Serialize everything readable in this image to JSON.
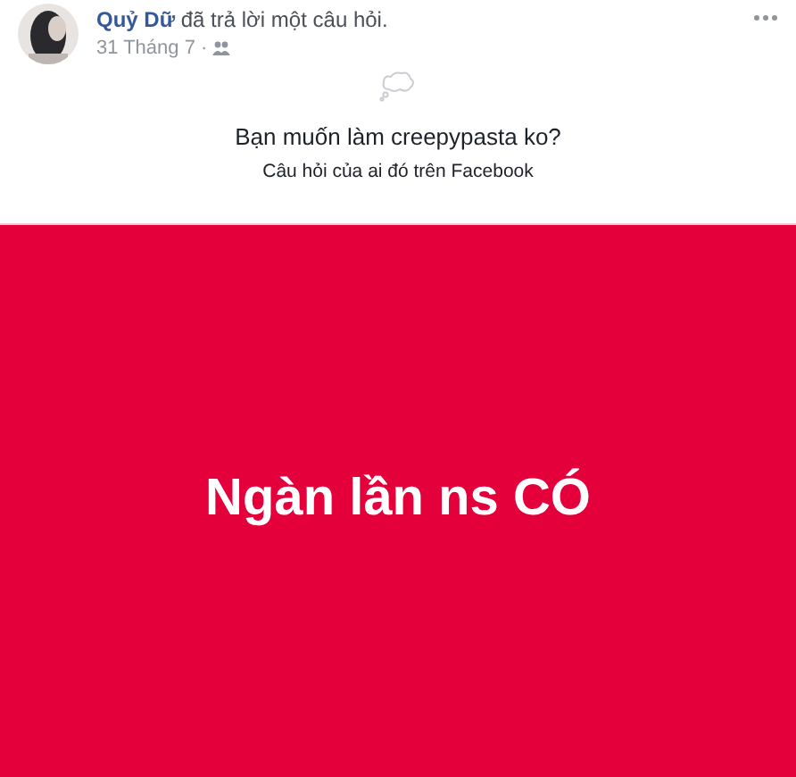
{
  "post": {
    "author": "Quỷ Dữ",
    "action": "đã trả lời một câu hỏi.",
    "date": "31 Tháng 7 ·"
  },
  "question": {
    "text": "Bạn muốn làm creepypasta ko?",
    "source": "Câu hỏi của ai đó trên Facebook"
  },
  "answer": {
    "text": "Ngàn lần ns CÓ",
    "color": "#e4003a"
  }
}
